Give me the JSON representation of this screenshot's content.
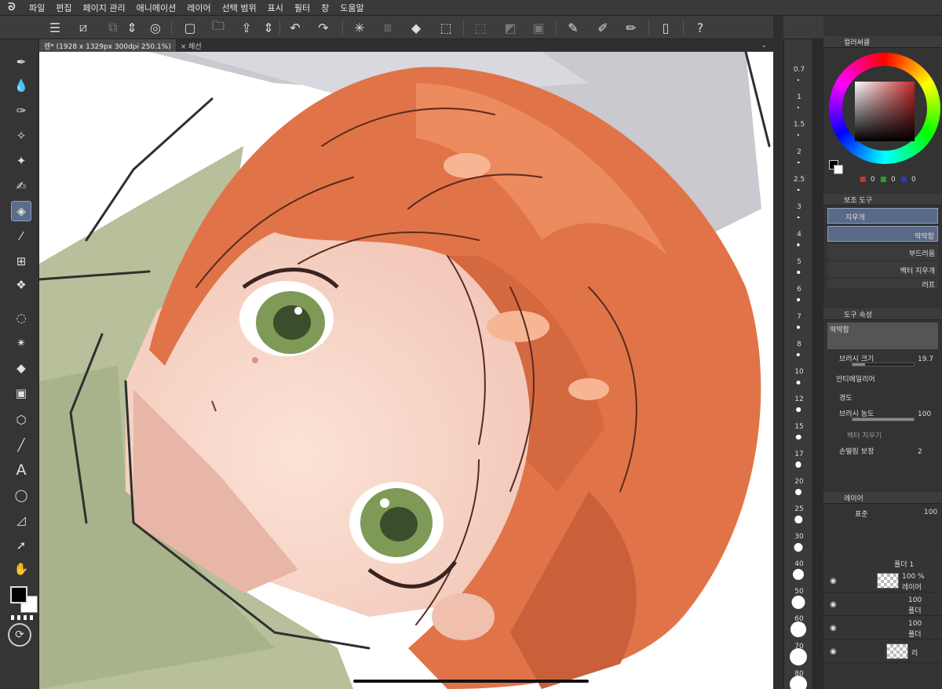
{
  "menubar": {
    "logo": "ᘐ",
    "items": [
      "파일",
      "편집",
      "페이지 관리",
      "애니메이션",
      "레이어",
      "선택 범위",
      "표시",
      "필터",
      "창",
      "도움말"
    ]
  },
  "commandbar": {
    "icons": [
      "menu-icon",
      "fit-icon",
      "transform-icon",
      "pattern-icon",
      "badge-icon",
      "new-icon",
      "open-icon",
      "export-icon",
      "stepper-icon",
      "undo-icon",
      "redo-icon",
      "loading-icon",
      "clear-icon",
      "fill-icon",
      "select-all-icon",
      "deselect-icon",
      "invert-icon",
      "border-icon",
      "ruler-icon",
      "brush-icon",
      "line-icon",
      "device-icon",
      "help-icon"
    ]
  },
  "tabs": [
    {
      "label": "렌* (1928 x 1329px 300dpi 250.1%)",
      "active": true
    },
    {
      "label": "× 헤선",
      "active": false
    }
  ],
  "toolbox": {
    "tools": [
      "pen",
      "water",
      "marker",
      "airbrush",
      "sparkle",
      "inking",
      "eraser",
      "dropper",
      "grid",
      "blend",
      "lasso",
      "magic",
      "bucket",
      "gradient",
      "3d",
      "line",
      "text",
      "balloon",
      "ruler",
      "pointer",
      "hand"
    ],
    "active": "eraser",
    "text_tool": "A"
  },
  "brush_sizes": [
    "0.7",
    "1",
    "1.5",
    "2",
    "2.5",
    "3",
    "4",
    "5",
    "6",
    "7",
    "8",
    "10",
    "12",
    "15",
    "17",
    "20",
    "25",
    "30",
    "40",
    "50",
    "60",
    "70",
    "80"
  ],
  "color_wheel": {
    "title": "컬러써클",
    "fg_color": "#000000",
    "bg_color": "#ffffff",
    "rgb": [
      "0",
      "0",
      "0"
    ],
    "accent": "#c42a2a"
  },
  "subtool": {
    "title": "보조 도구",
    "group": "지우개",
    "items": [
      "딱딱함",
      "부드러움",
      "벡터 지우개",
      "러프"
    ],
    "selected": "딱딱함"
  },
  "tool_property": {
    "title": "도구 속성",
    "preset": "딱딱함",
    "brush_size_label": "브러시 크기",
    "brush_size_value": "19.7",
    "antialias_label": "안티에일리어",
    "hardness_label": "경도",
    "density_label": "브러시 농도",
    "density_value": "100",
    "vector_erase_label": "벡터 지우기",
    "stabilize_label": "손떨림 보정",
    "stabilize_value": "2",
    "density_fill": 1.0,
    "size_fill": 0.2
  },
  "layers": {
    "title": "레이어",
    "blend_mode": "표준",
    "opacity": "100",
    "rows": [
      {
        "pct": "",
        "name": "폴더 1"
      },
      {
        "pct": "100 %",
        "name": "레이어"
      },
      {
        "pct": "100",
        "name": "폴더"
      },
      {
        "pct": "100",
        "name": "폴더"
      },
      {
        "pct": "",
        "name": "리"
      }
    ]
  }
}
